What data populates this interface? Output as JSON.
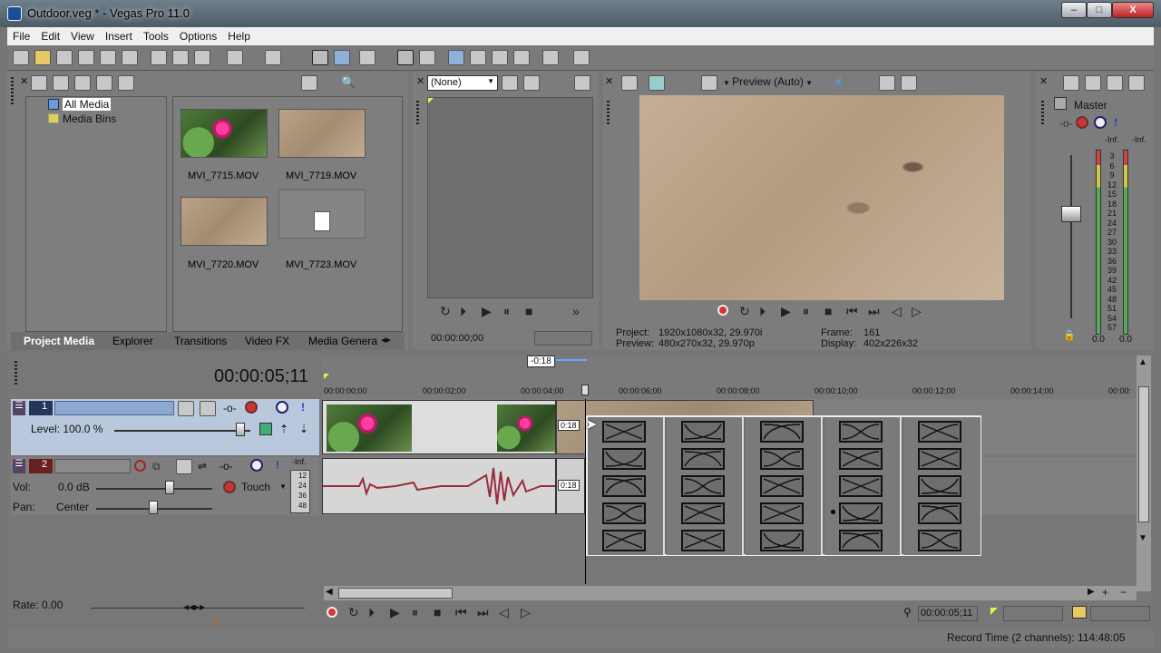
{
  "window": {
    "title": "Outdoor.veg * - Vegas Pro 11.0",
    "minimize": "–",
    "maximize": "□",
    "close": "X"
  },
  "menu": [
    "File",
    "Edit",
    "View",
    "Insert",
    "Tools",
    "Options",
    "Help"
  ],
  "media": {
    "tree": [
      "All Media",
      "Media Bins"
    ],
    "items": [
      {
        "name": "MVI_7715.MOV",
        "kind": "flower"
      },
      {
        "name": "MVI_7719.MOV",
        "kind": "sand"
      },
      {
        "name": "MVI_7720.MOV",
        "kind": "sand"
      },
      {
        "name": "MVI_7723.MOV",
        "kind": "file"
      }
    ],
    "tabs": [
      "Project Media",
      "Explorer",
      "Transitions",
      "Video FX",
      "Media Generat"
    ]
  },
  "trimmer": {
    "preset": "(None)",
    "timecode": "00:00:00;00"
  },
  "preview": {
    "mode": "Preview (Auto)",
    "project_label": "Project:",
    "project_value": "1920x1080x32, 29.970i",
    "preview_label": "Preview:",
    "preview_value": "480x270x32, 29.970p",
    "frame_label": "Frame:",
    "frame_value": "161",
    "display_label": "Display:",
    "display_value": "402x226x32"
  },
  "mixer": {
    "title": "Master",
    "left_peak": "-Inf.",
    "right_peak": "-Inf.",
    "scale": [
      "3",
      "6",
      "9",
      "12",
      "15",
      "18",
      "21",
      "24",
      "27",
      "30",
      "33",
      "36",
      "39",
      "42",
      "45",
      "48",
      "51",
      "54",
      "57"
    ],
    "left_value": "0.0",
    "right_value": "0.0"
  },
  "timeline": {
    "cursor": "00:00:05;11",
    "marker": "-0:18",
    "ruler": [
      "00:00:00;00",
      "00:00:02;00",
      "00:00:04;00",
      "00:00:06;00",
      "00:00:08;00",
      "00:00:10;00",
      "00:00:12;00",
      "00:00:14;00",
      "00:00:"
    ],
    "track1": {
      "number": "1",
      "level_label": "Level: 100.0 %",
      "fade_label": "0:18"
    },
    "track2": {
      "number": "2",
      "vol_label": "Vol:",
      "vol_value": "0.0 dB",
      "pan_label": "Pan:",
      "pan_value": "Center",
      "mode": "Touch",
      "meter_peak": "-Inf.",
      "meter_scale": [
        "12",
        "24",
        "36",
        "48"
      ],
      "fade_label": "0:18"
    },
    "rate": "Rate: 0.00",
    "end_timecode": "00:00:05;11"
  },
  "status": {
    "record_time": "Record Time (2 channels): 114:48:05"
  }
}
